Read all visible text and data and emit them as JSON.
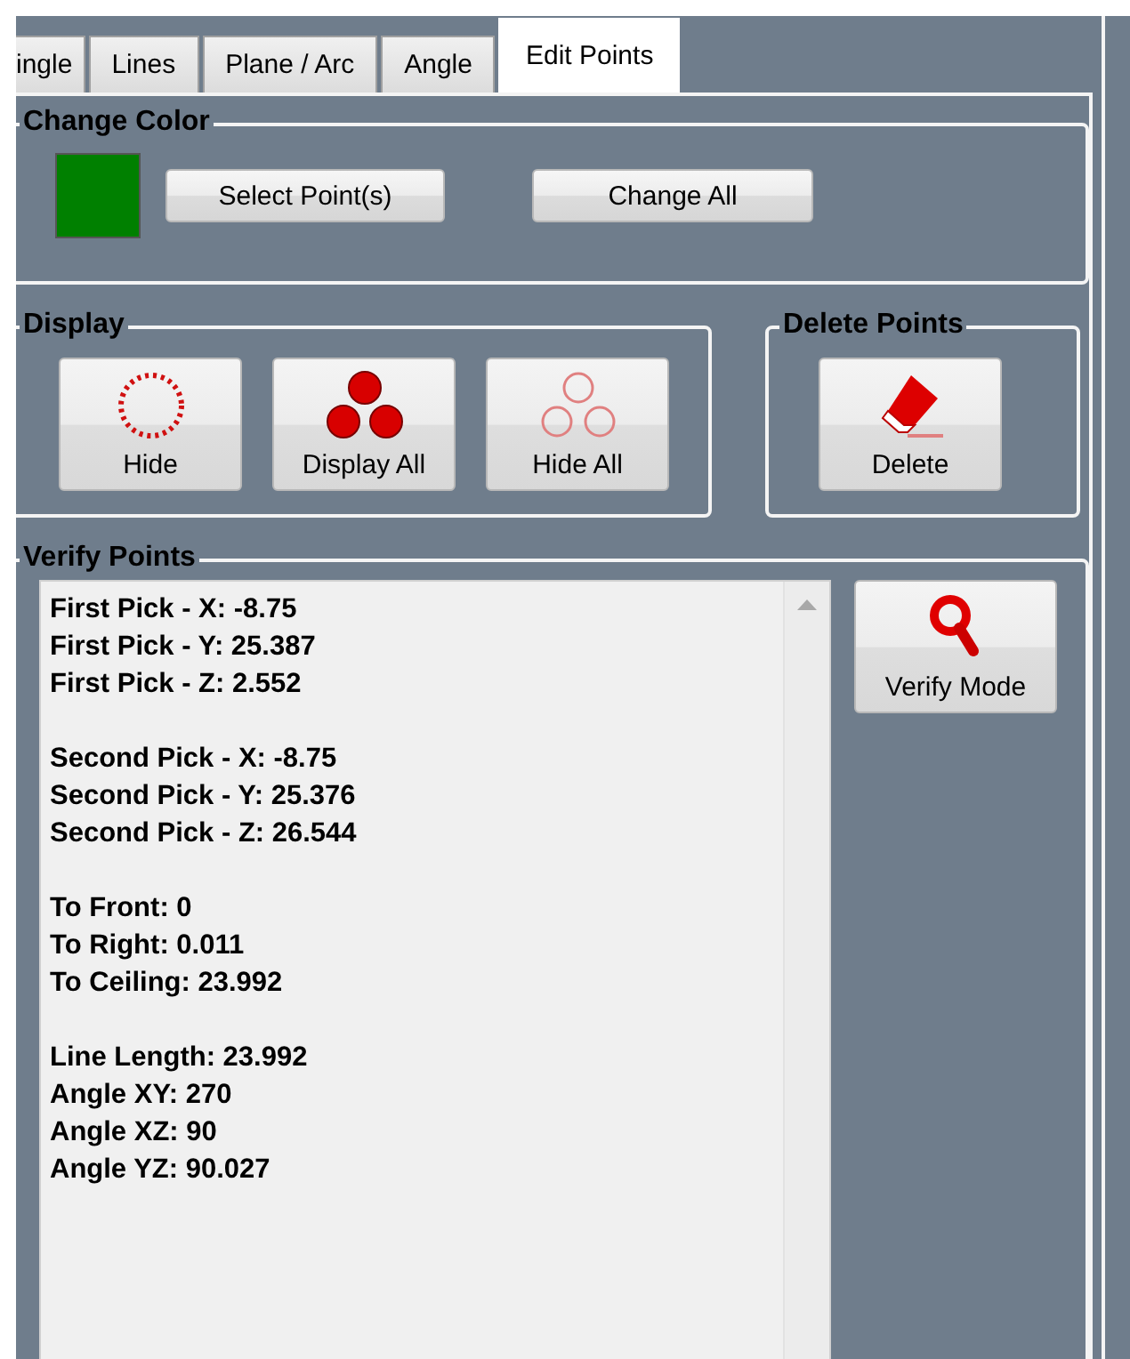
{
  "tabs": [
    {
      "label": "ingle",
      "selected": false
    },
    {
      "label": "Lines",
      "selected": false
    },
    {
      "label": "Plane / Arc",
      "selected": false
    },
    {
      "label": "Angle",
      "selected": false
    },
    {
      "label": "Edit Points",
      "selected": true
    }
  ],
  "change_color": {
    "title": "Change Color",
    "color": "#008000",
    "buttons": [
      "Select Point(s)",
      "Change All"
    ]
  },
  "display": {
    "title": "Display",
    "buttons": [
      {
        "label": "Hide",
        "kind": "hide"
      },
      {
        "label": "Display All",
        "kind": "show"
      },
      {
        "label": "Hide All",
        "kind": "hideall"
      }
    ]
  },
  "delete_points": {
    "title": "Delete Points",
    "buttons": [
      {
        "label": "Delete",
        "kind": "erase"
      }
    ]
  },
  "verify_points": {
    "title": "Verify Points",
    "groups": [
      [
        "First Pick - X: -8.75",
        "First Pick - Y: 25.387",
        "First Pick - Z: 2.552"
      ],
      [
        "Second Pick - X: -8.75",
        "Second Pick - Y: 25.376",
        "Second Pick - Z: 26.544"
      ],
      [
        "To Front: 0",
        "To Right: 0.011",
        "To Ceiling: 23.992"
      ],
      [
        "Line Length: 23.992",
        "Angle XY: 270",
        "Angle XZ: 90",
        "Angle YZ: 90.027"
      ]
    ],
    "button": {
      "label": "Verify Mode",
      "kind": "verify"
    }
  }
}
